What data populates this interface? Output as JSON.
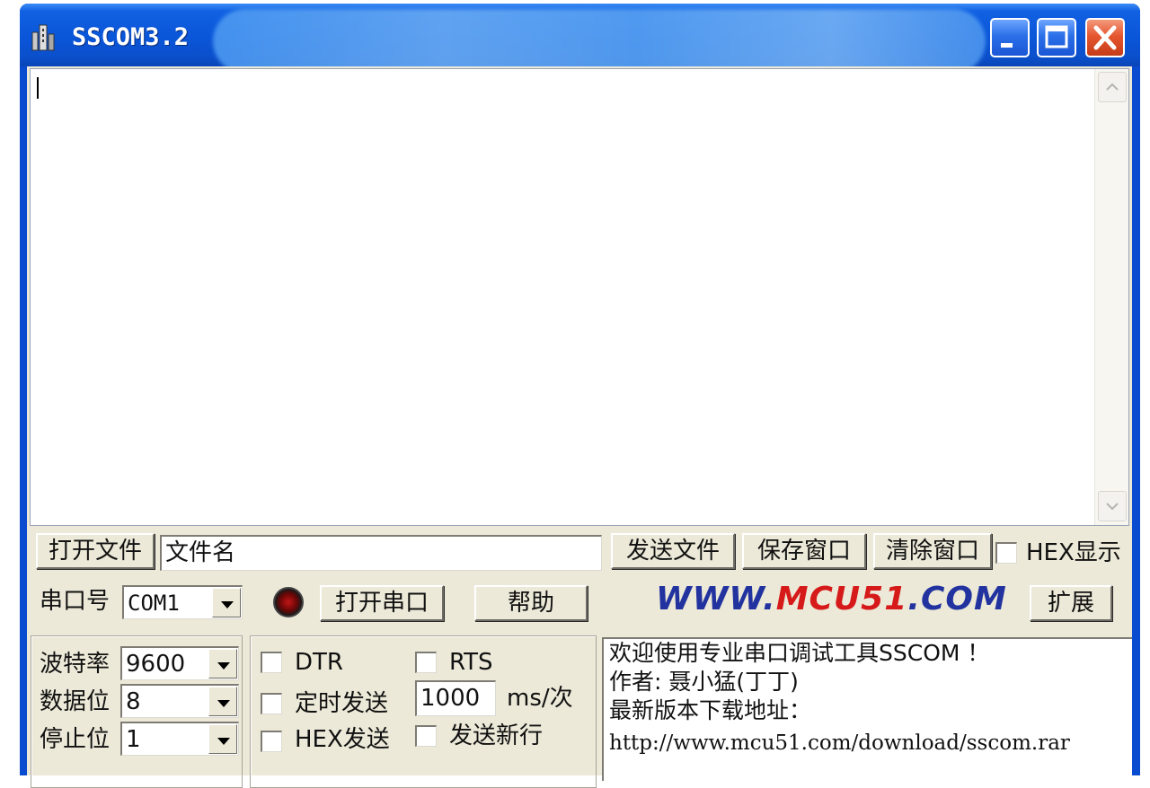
{
  "window": {
    "title": "SSCOM3.2",
    "colors": {
      "titlebar": "#0a55d8",
      "client": "#ece9d8",
      "close_button": "#e5562f"
    }
  },
  "toolbar": {
    "open_file_label": "打开文件",
    "filename_value": "文件名",
    "send_file_label": "发送文件",
    "save_window_label": "保存窗口",
    "clear_window_label": "清除窗口",
    "hex_display_label": "HEX显示"
  },
  "port_row": {
    "port_label": "串口号",
    "port_value": "COM1",
    "open_port_label": "打开串口",
    "help_label": "帮助",
    "logo_www": "WWW.",
    "logo_mcu": "MCU51",
    "logo_com": ".COM",
    "logo_colors": {
      "www": "#2233a0",
      "mcu": "#d61a1a",
      "com": "#2233a0"
    },
    "expand_label": "扩展"
  },
  "settings": {
    "baud_label": "波特率",
    "baud_value": "9600",
    "databits_label": "数据位",
    "databits_value": "8",
    "stopbits_label": "停止位",
    "stopbits_value": "1"
  },
  "options": {
    "dtr_label": "DTR",
    "rts_label": "RTS",
    "timed_send_label": "定时发送",
    "interval_value": "1000",
    "interval_unit": "ms/次",
    "hex_send_label": "HEX发送",
    "send_newline_label": "发送新行"
  },
  "info": {
    "lines": [
      "欢迎使用专业串口调试工具SSCOM ！",
      "作者: 聂小猛(丁丁)",
      "最新版本下载地址：",
      "http://www.mcu51.com/download/sscom.rar"
    ]
  },
  "icons": {
    "app": "sscom-app-icon",
    "minimize": "minimize-icon",
    "maximize": "maximize-icon",
    "close": "close-icon",
    "status": "status-led-icon"
  }
}
